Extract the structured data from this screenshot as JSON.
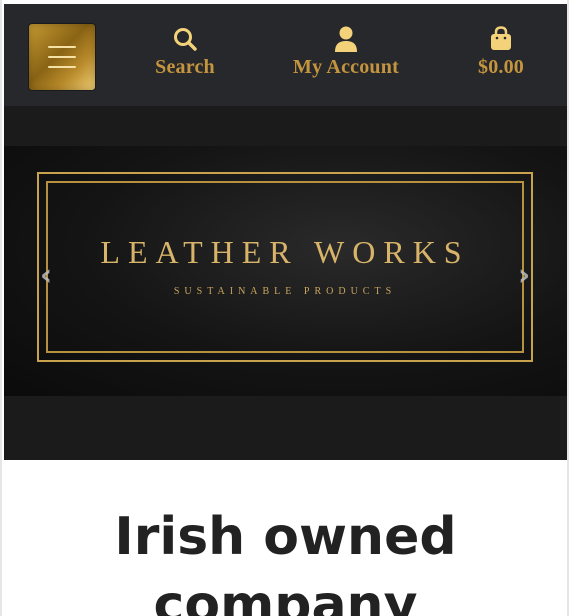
{
  "header": {
    "menu_icon": "hamburger-icon",
    "nav": {
      "search": {
        "label": "Search",
        "icon": "search-icon"
      },
      "account": {
        "label": "My Account",
        "icon": "user-icon"
      },
      "cart": {
        "label": "$0.00",
        "icon": "shopping-bag-icon"
      }
    }
  },
  "hero": {
    "brand_title": "LEATHER WORKS",
    "brand_subtitle": "SUSTAINABLE PRODUCTS",
    "prev_icon": "chevron-left-icon",
    "next_icon": "chevron-right-icon"
  },
  "main": {
    "headline": "Irish owned company"
  },
  "colors": {
    "header_bg": "#27282b",
    "gold": "#c4953e",
    "hero_bg": "#1b1b1b",
    "text": "#222222"
  }
}
